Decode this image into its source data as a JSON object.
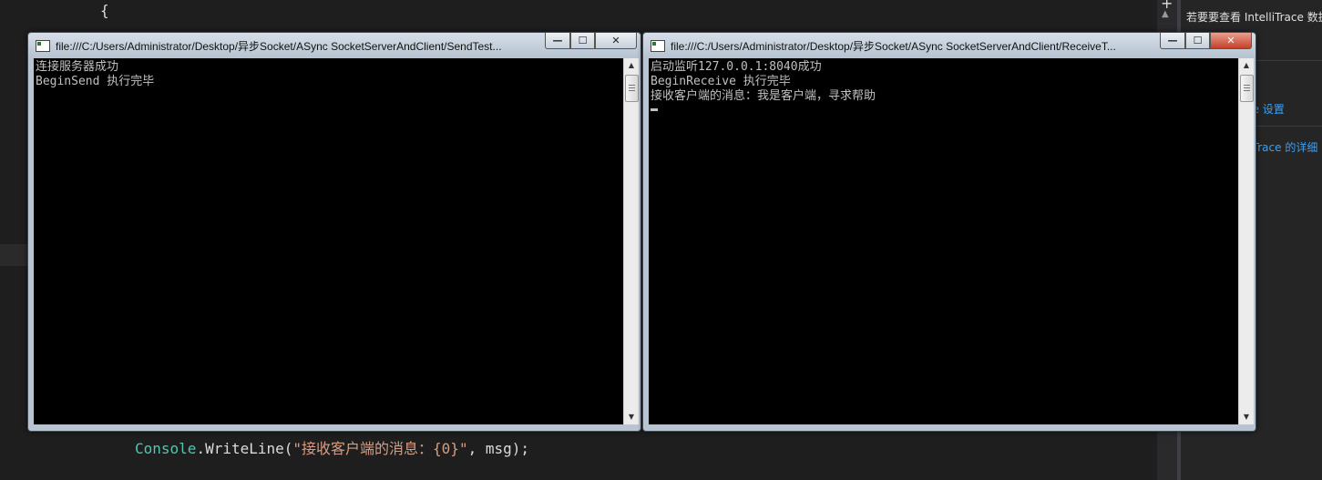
{
  "editor": {
    "brace": "{",
    "code": {
      "type": "Console",
      "method": ".WriteLine(",
      "string": "\"接收客户端的消息：{0}\"",
      "rest": ", msg);"
    }
  },
  "side_panel": {
    "top_text": "若要要查看 IntelliTrace 数据，",
    "link1": "ce 设置",
    "link2": "liTrace 的详细"
  },
  "windows": [
    {
      "title": "file:///C:/Users/Administrator/Desktop/异步Socket/ASync SocketServerAndClient/SendTest...",
      "lines": [
        "连接服务器成功",
        "BeginSend 执行完毕"
      ]
    },
    {
      "title": "file:///C:/Users/Administrator/Desktop/异步Socket/ASync SocketServerAndClient/ReceiveT...",
      "lines": [
        "启动监听127.0.0.1:8040成功",
        "BeginReceive 执行完毕",
        "接收客户端的消息：我是客户端，寻求帮助"
      ]
    }
  ],
  "caption": {
    "min": "—",
    "max": "☐",
    "close": "✕"
  }
}
